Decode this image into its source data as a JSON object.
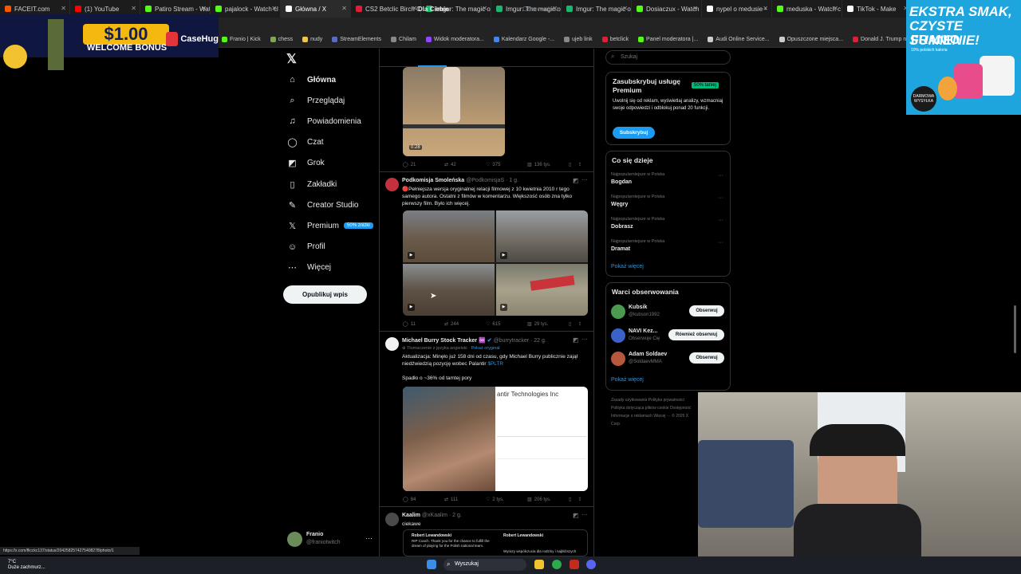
{
  "tabs": [
    {
      "label": "FACEIT.com",
      "color": "#ff5500",
      "active": false
    },
    {
      "label": "(1) YouTube",
      "color": "#ff0000",
      "active": false
    },
    {
      "label": "Patiro Stream - Wat",
      "color": "#53fc18",
      "active": false
    },
    {
      "label": "pajalock - Watch cl",
      "color": "#53fc18",
      "active": false
    },
    {
      "label": "Główna / X",
      "color": "#ffffff",
      "active": true
    },
    {
      "label": "CS2 Betclic Birch C",
      "color": "#e21d36",
      "active": false
    },
    {
      "label": "Imgur: The magic o",
      "color": "#1bb76e",
      "active": false
    },
    {
      "label": "Imgur: The magic o",
      "color": "#1bb76e",
      "active": false
    },
    {
      "label": "Imgur: The magic o",
      "color": "#1bb76e",
      "active": false
    },
    {
      "label": "Dosiaczux - Watch",
      "color": "#53fc18",
      "active": false
    },
    {
      "label": "nypel o medusie -",
      "color": "#ffffff",
      "active": false
    },
    {
      "label": "meduska - Watch c",
      "color": "#53fc18",
      "active": false
    },
    {
      "label": "TikTok - Make",
      "color": "#ffffff",
      "active": false
    }
  ],
  "bookmarks": [
    {
      "label": "Franio | Kick",
      "color": "#53fc18"
    },
    {
      "label": "chess",
      "color": "#7fa650"
    },
    {
      "label": "nudy",
      "color": "#f4c542"
    },
    {
      "label": "StreamElements",
      "color": "#5c6bc0"
    },
    {
      "label": "Chilam",
      "color": "#888888"
    },
    {
      "label": "Widok moderatora...",
      "color": "#9146ff"
    },
    {
      "label": "Kalendarz Google -...",
      "color": "#4285f4"
    },
    {
      "label": "ujeb link",
      "color": "#888888"
    },
    {
      "label": "betclick",
      "color": "#e21d36"
    },
    {
      "label": "Panel moderatora |...",
      "color": "#53fc18"
    },
    {
      "label": "Audi Online Service...",
      "color": "#cccccc"
    },
    {
      "label": "Opuszczone miejsca...",
      "color": "#cccccc"
    },
    {
      "label": "Donald J. Trump ne...",
      "color": "#e21d36"
    }
  ],
  "ad": {
    "price": "$1.00",
    "bonus": "WELCOME BONUS",
    "brand": "CaseHug"
  },
  "promo": {
    "headline": "EKSTRA SMAK, CZYSTE SUMIENIE!",
    "brand": "FRANIO",
    "sub": "10% polskich kaloria",
    "badge": "DARMOWA WYSYŁKA"
  },
  "nav": [
    {
      "label": "Główna",
      "icon": "home-icon",
      "glyph": "⌂",
      "bold": true
    },
    {
      "label": "Przeglądaj",
      "icon": "search-icon",
      "glyph": "⌕",
      "bold": false
    },
    {
      "label": "Powiadomienia",
      "icon": "bell-icon",
      "glyph": "♫",
      "bold": false
    },
    {
      "label": "Czat",
      "icon": "chat-icon",
      "glyph": "◯",
      "bold": false
    },
    {
      "label": "Grok",
      "icon": "grok-icon",
      "glyph": "◩",
      "bold": false
    },
    {
      "label": "Zakładki",
      "icon": "bookmark-icon",
      "glyph": "▯",
      "bold": false
    },
    {
      "label": "Creator Studio",
      "icon": "creator-icon",
      "glyph": "✎",
      "bold": false
    },
    {
      "label": "Premium",
      "icon": "x-premium-icon",
      "glyph": "𝕏",
      "bold": false,
      "pill": "50% zniżki"
    },
    {
      "label": "Profil",
      "icon": "profile-icon",
      "glyph": "☺",
      "bold": false
    },
    {
      "label": "Więcej",
      "icon": "more-icon",
      "glyph": "⋯",
      "bold": false
    }
  ],
  "post_button": "Opublikuj wpis",
  "account": {
    "name": "Franio",
    "handle": "@franiotwitch"
  },
  "feed_tabs": {
    "for_you": "Dla Ciebie",
    "following": "Obserwujesz"
  },
  "tweet0": {
    "duration": "0:28",
    "replies": "21",
    "reposts": "42",
    "likes": "375",
    "views": "136 tys."
  },
  "tweet1": {
    "name": "Podkomisja Smoleńska",
    "handle": "@PodkomisjaS · 1 g.",
    "text": "🔴Pełniejsza wersja oryginalnej relacji filmowej z 10 kwietnia 2010 r tego samego autora. Ostatni z filmów w komentarzu. Większość osób zna tylko pierwszy film. Było ich więcej.",
    "replies": "11",
    "reposts": "244",
    "likes": "615",
    "views": "29 tys."
  },
  "tweet2": {
    "name": "Michael Burry Stock Tracker ♾️",
    "handle": "@burrytracker · 22 g.",
    "translated": "Tłumaczenie z języka angielski",
    "show_original": "Pokaż oryginał",
    "text": "Aktualizacja: Minęło już 158 dni od czasu, gdy Michael Burry publicznie zajął niedźwiedzią pozycję wobec Palantir",
    "cashtag": "$PLTR",
    "text2": "Spadło o ~36% od tamtej pory",
    "chart_title": "antir Technologies Inc",
    "replies": "84",
    "reposts": "111",
    "likes": "2 tys.",
    "views": "206 tys."
  },
  "tweet3": {
    "name": "Kaalim",
    "handle": "@xKaalim · 2 g.",
    "text": "ciekawe",
    "quote_name": "Robert Lewandowski",
    "quote_text": "RIP Coach. Thank you for the chance to fulfill the dream of playing for the Polish national team.",
    "quote2_name": "Robert Lewandowski",
    "quote2_text": "Wyrazy współczucia dla rodziny i najbliższych"
  },
  "search_placeholder": "Szukaj",
  "premium": {
    "title": "Zasubskrybuj usługę Premium",
    "badge": "50% taniej",
    "text": "Uwolnij się od reklam, wyświetlaj analizy, wzmacniaj swoje odpowiedzi i odblokuj ponad 20 funkcji.",
    "button": "Subskrybuj"
  },
  "trends": {
    "title": "Co się dzieje",
    "items": [
      {
        "context": "Najpopularniejsze w Polska",
        "name": "Bogdan"
      },
      {
        "context": "Najpopularniejsze w Polska",
        "name": "Węgry"
      },
      {
        "context": "Najpopularniejsze w Polska",
        "name": "Dobrasz"
      },
      {
        "context": "Najpopularniejsze w Polska",
        "name": "Dramat"
      }
    ],
    "show_more": "Pokaż więcej"
  },
  "follow": {
    "title": "Warci obserwowania",
    "items": [
      {
        "name": "Kubsik",
        "handle": "@kubson1992",
        "button": "Obserwuj",
        "color": "#4c9a52"
      },
      {
        "name": "NAVI Kez...",
        "handle": "Obserwuje Cię",
        "button": "Również obserwuj",
        "color": "#3a62c9"
      },
      {
        "name": "Adam Soldaev",
        "handle": "@SoldaevMMA",
        "button": "Obserwuj",
        "color": "#b5583b"
      }
    ],
    "show_more": "Pokaż więcej"
  },
  "footer": [
    "Zasady użytkowania",
    "Polityka prywatności",
    "Polityka dotycząca plików cookie",
    "Dostępność",
    "Informacje o reklamach",
    "Więcej ···",
    "© 2025 X Corp."
  ],
  "status_url": "https://x.com/flicckc137/status/2042582574275408278/photo/1",
  "weather": {
    "temp": "7°C",
    "desc": "Duże zachmurz..."
  },
  "taskbar_search": "Wyszukaj"
}
